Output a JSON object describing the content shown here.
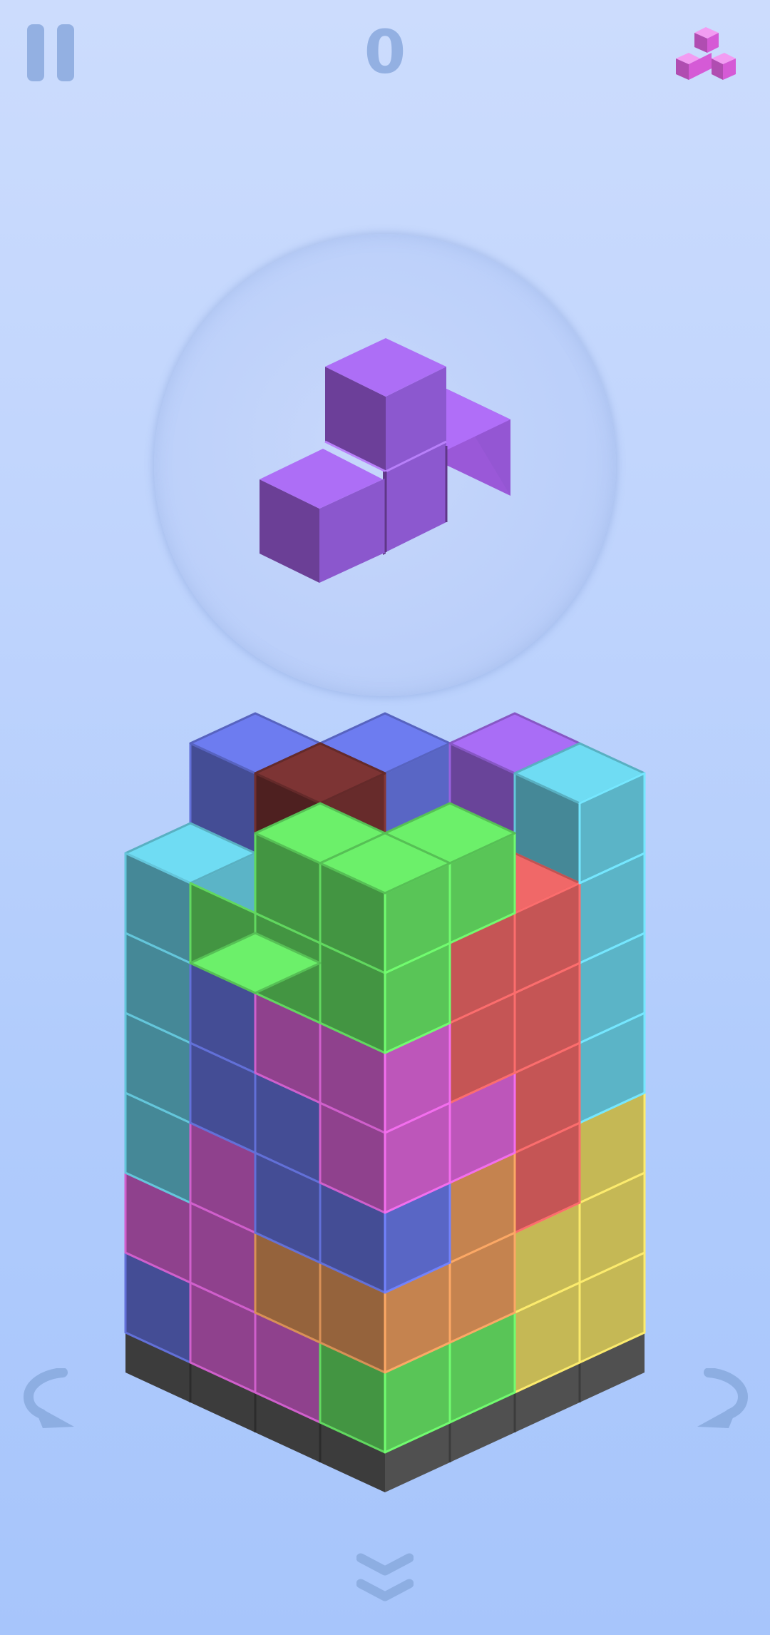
{
  "hud": {
    "score": "0",
    "pause_icon": "pause-icon",
    "next_piece_icon": "stacked-cubes-icon",
    "next_piece_color": "#e374e4"
  },
  "preview": {
    "piece_color": "#9b66e3",
    "piece_cells": 4
  },
  "controls": {
    "rotate_left_icon": "rotate-left-arrow-icon",
    "rotate_right_icon": "rotate-right-arrow-icon",
    "drop_icon": "double-chevron-down-icon",
    "icon_color": "#8daee2"
  },
  "tower": {
    "visible_columns_left_face": 4,
    "visible_columns_right_face": 4,
    "palette": {
      "cyan": "#6fdcf3",
      "blue": "#6d7cf0",
      "purple": "#a96df6",
      "maroon": "#7d3434",
      "dark-green": "#37782f",
      "green": "#6cf06a",
      "coral": "#f06868",
      "magenta": "#e769e3",
      "orange": "#f0a060",
      "yellow": "#f0e068",
      "base": "#3f3f3f"
    }
  }
}
